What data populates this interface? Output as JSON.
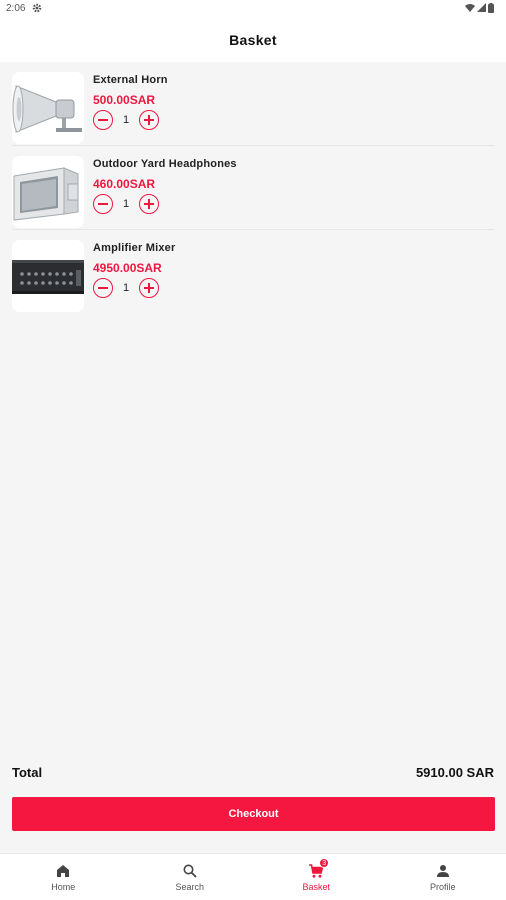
{
  "status_bar": {
    "time": "2:06"
  },
  "app_bar": {
    "title": "Basket"
  },
  "items": [
    {
      "name": "External Horn",
      "price": "500.00SAR",
      "quantity": "1",
      "image": "horn-speaker"
    },
    {
      "name": "Outdoor Yard Headphones",
      "price": "460.00SAR",
      "quantity": "1",
      "image": "box-speaker"
    },
    {
      "name": "Amplifier Mixer",
      "price": "4950.00SAR",
      "quantity": "1",
      "image": "amplifier-unit"
    }
  ],
  "summary": {
    "total_label": "Total",
    "total_value": "5910.00 SAR"
  },
  "checkout": {
    "label": "Checkout"
  },
  "nav": {
    "items": [
      {
        "label": "Home",
        "icon": "home-icon"
      },
      {
        "label": "Search",
        "icon": "search-icon"
      },
      {
        "label": "Basket",
        "icon": "cart-icon",
        "badge": "3",
        "active": true
      },
      {
        "label": "Profile",
        "icon": "person-icon"
      }
    ]
  },
  "colors": {
    "accent": "#f0173f",
    "background": "#f5f5f5"
  }
}
